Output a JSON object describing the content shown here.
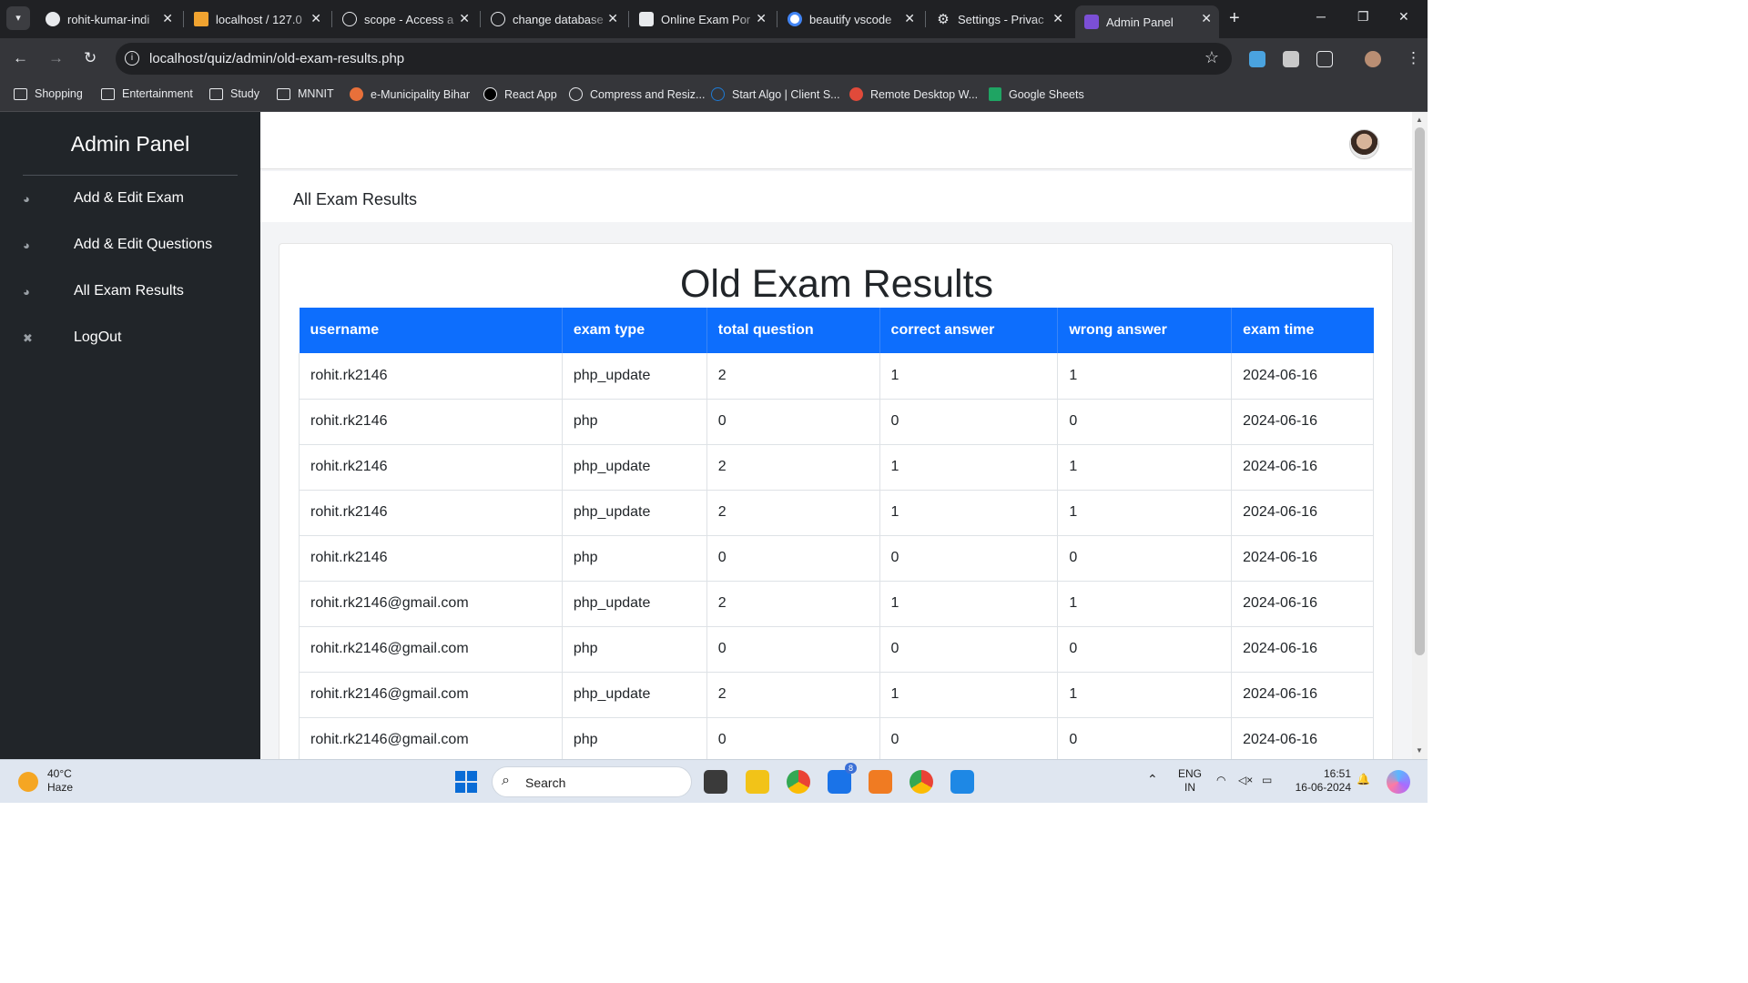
{
  "browser": {
    "tabs": [
      {
        "label": "rohit-kumar-indi",
        "icon": "github-icon"
      },
      {
        "label": "localhost / 127.0",
        "icon": "phpmyadmin-icon"
      },
      {
        "label": "scope - Access a",
        "icon": "chatgpt-icon"
      },
      {
        "label": "change database",
        "icon": "chatgpt-icon"
      },
      {
        "label": "Online Exam Por",
        "icon": "chatgpt-icon"
      },
      {
        "label": "beautify vscode",
        "icon": "google-icon"
      },
      {
        "label": "Settings - Privac",
        "icon": "gear-icon"
      },
      {
        "label": "Admin Panel",
        "icon": "colorlib-icon"
      }
    ],
    "url": "localhost/quiz/admin/old-exam-results.php",
    "bookmarks": [
      "Shopping",
      "Entertainment",
      "Study",
      "MNNIT",
      "e-Municipality Bihar",
      "React App",
      "Compress and Resiz...",
      "Start Algo | Client S...",
      "Remote Desktop W...",
      "Google Sheets"
    ]
  },
  "sidebar": {
    "title": "Admin Panel",
    "items": [
      {
        "label": "Add & Edit Exam",
        "icon": "dashboard-icon"
      },
      {
        "label": "Add & Edit Questions",
        "icon": "dashboard-icon"
      },
      {
        "label": "All Exam Results",
        "icon": "dashboard-icon"
      },
      {
        "label": "LogOut",
        "icon": "close-icon"
      }
    ]
  },
  "page": {
    "subheader": "All Exam Results",
    "card_title": "Old Exam Results",
    "columns": [
      "username",
      "exam type",
      "total question",
      "correct answer",
      "wrong answer",
      "exam time"
    ],
    "rows": [
      [
        "rohit.rk2146",
        "php_update",
        "2",
        "1",
        "1",
        "2024-06-16"
      ],
      [
        "rohit.rk2146",
        "php",
        "0",
        "0",
        "0",
        "2024-06-16"
      ],
      [
        "rohit.rk2146",
        "php_update",
        "2",
        "1",
        "1",
        "2024-06-16"
      ],
      [
        "rohit.rk2146",
        "php_update",
        "2",
        "1",
        "1",
        "2024-06-16"
      ],
      [
        "rohit.rk2146",
        "php",
        "0",
        "0",
        "0",
        "2024-06-16"
      ],
      [
        "rohit.rk2146@gmail.com",
        "php_update",
        "2",
        "1",
        "1",
        "2024-06-16"
      ],
      [
        "rohit.rk2146@gmail.com",
        "php",
        "0",
        "0",
        "0",
        "2024-06-16"
      ],
      [
        "rohit.rk2146@gmail.com",
        "php_update",
        "2",
        "1",
        "1",
        "2024-06-16"
      ],
      [
        "rohit.rk2146@gmail.com",
        "php",
        "0",
        "0",
        "0",
        "2024-06-16"
      ]
    ]
  },
  "taskbar": {
    "weather_temp": "40°C",
    "weather_cond": "Haze",
    "search_label": "Search",
    "mail_badge": "8",
    "lang_1": "ENG",
    "lang_2": "IN",
    "time": "16:51",
    "date": "16-06-2024"
  },
  "colors": {
    "sidebar_bg": "#212529",
    "table_header_bg": "#0d6efd",
    "main_bg": "#f3f4f6"
  }
}
